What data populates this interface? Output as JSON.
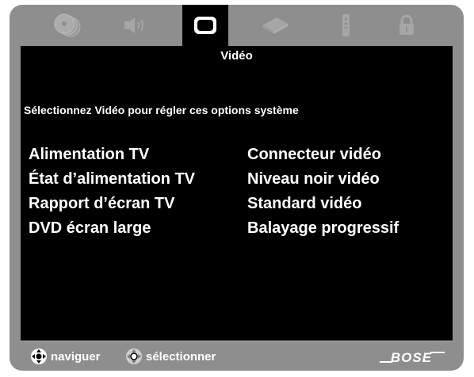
{
  "tabs": [
    {
      "icon": "disc-icon",
      "active": false
    },
    {
      "icon": "speaker-icon",
      "active": false
    },
    {
      "icon": "tv-icon",
      "active": true
    },
    {
      "icon": "dvd-player-icon",
      "active": false
    },
    {
      "icon": "remote-icon",
      "active": false
    },
    {
      "icon": "lock-icon",
      "active": false
    }
  ],
  "screen": {
    "title": "Vidéo",
    "instruction": "Sélectionnez Vidéo pour régler ces options système",
    "options_left": [
      "Alimentation TV",
      "État d’alimentation TV",
      "Rapport d’écran TV",
      "DVD écran large"
    ],
    "options_right": [
      "Connecteur vidéo",
      "Niveau noir vidéo",
      "Standard vidéo",
      "Balayage progressif"
    ]
  },
  "footer": {
    "navigate_label": "naviguer",
    "select_label": "sélectionner",
    "navigate_icon": "dpad-navigate-icon",
    "select_icon": "dpad-select-icon",
    "logo_text": "BOSE"
  },
  "colors": {
    "frame": "#8e8e8e",
    "screen": "#000000",
    "text": "#ffffff",
    "inactive_icon": "#a6a6a6"
  }
}
